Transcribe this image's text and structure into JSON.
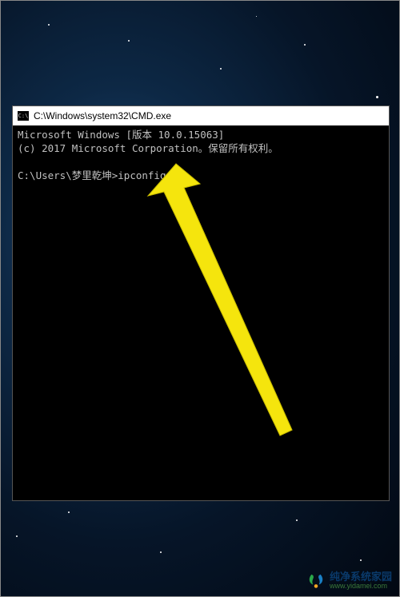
{
  "window": {
    "title": "C:\\Windows\\system32\\CMD.exe"
  },
  "console": {
    "line1": "Microsoft Windows [版本 10.0.15063]",
    "line2": "(c) 2017 Microsoft Corporation。保留所有权利。",
    "blank": "",
    "prompt": "C:\\Users\\梦里乾坤>",
    "command": "ipconfig"
  },
  "watermark": {
    "title": "纯净系统家园",
    "url": "www.yidamei.com"
  }
}
